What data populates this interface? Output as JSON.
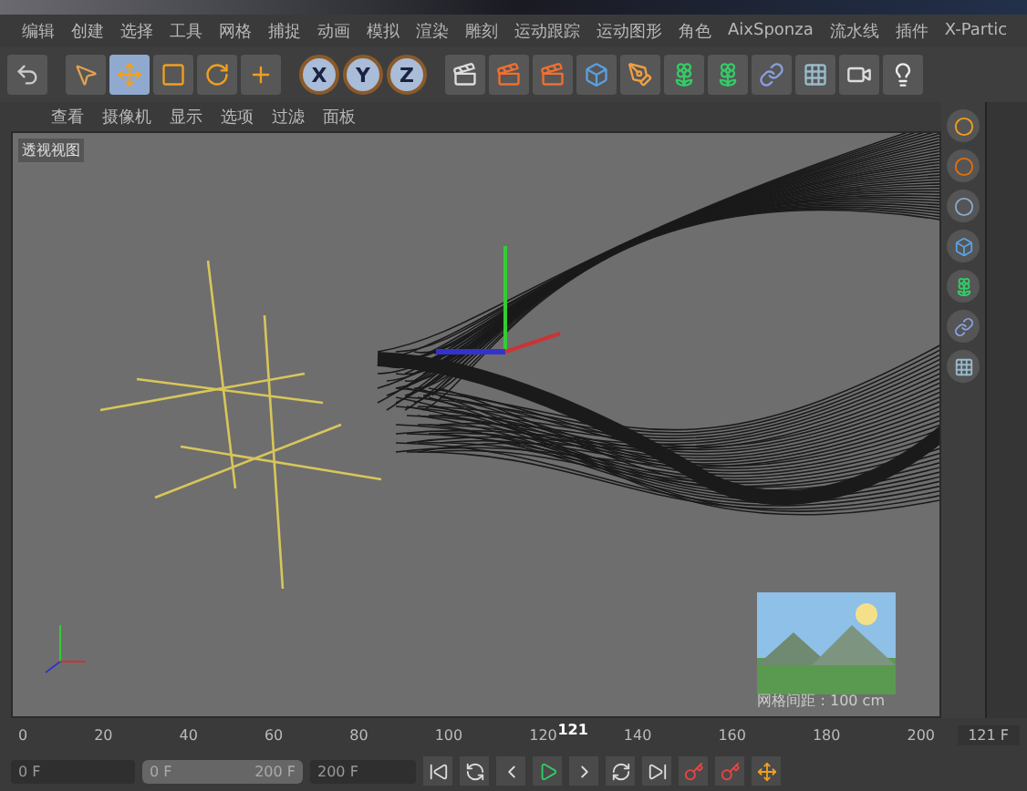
{
  "menu": [
    "编辑",
    "创建",
    "选择",
    "工具",
    "网格",
    "捕捉",
    "动画",
    "模拟",
    "渲染",
    "雕刻",
    "运动跟踪",
    "运动图形",
    "角色",
    "AixSponza",
    "流水线",
    "插件",
    "X-Partic"
  ],
  "axis_buttons": [
    "X",
    "Y",
    "Z"
  ],
  "view_menu": [
    "查看",
    "摄像机",
    "显示",
    "选项",
    "过滤",
    "面板"
  ],
  "viewport": {
    "label": "透视视图",
    "grid_note": "网格间距 : 100 cm"
  },
  "timeline": {
    "ticks": [
      "0",
      "20",
      "40",
      "60",
      "80",
      "100",
      "120",
      "140",
      "160",
      "180",
      "200"
    ],
    "current": "121",
    "level": 0.605,
    "frame_field": "121 F"
  },
  "controls": {
    "start": "0 F",
    "range": {
      "start": "0 F",
      "end": "200 F",
      "level": 1
    },
    "end": "200 F"
  }
}
